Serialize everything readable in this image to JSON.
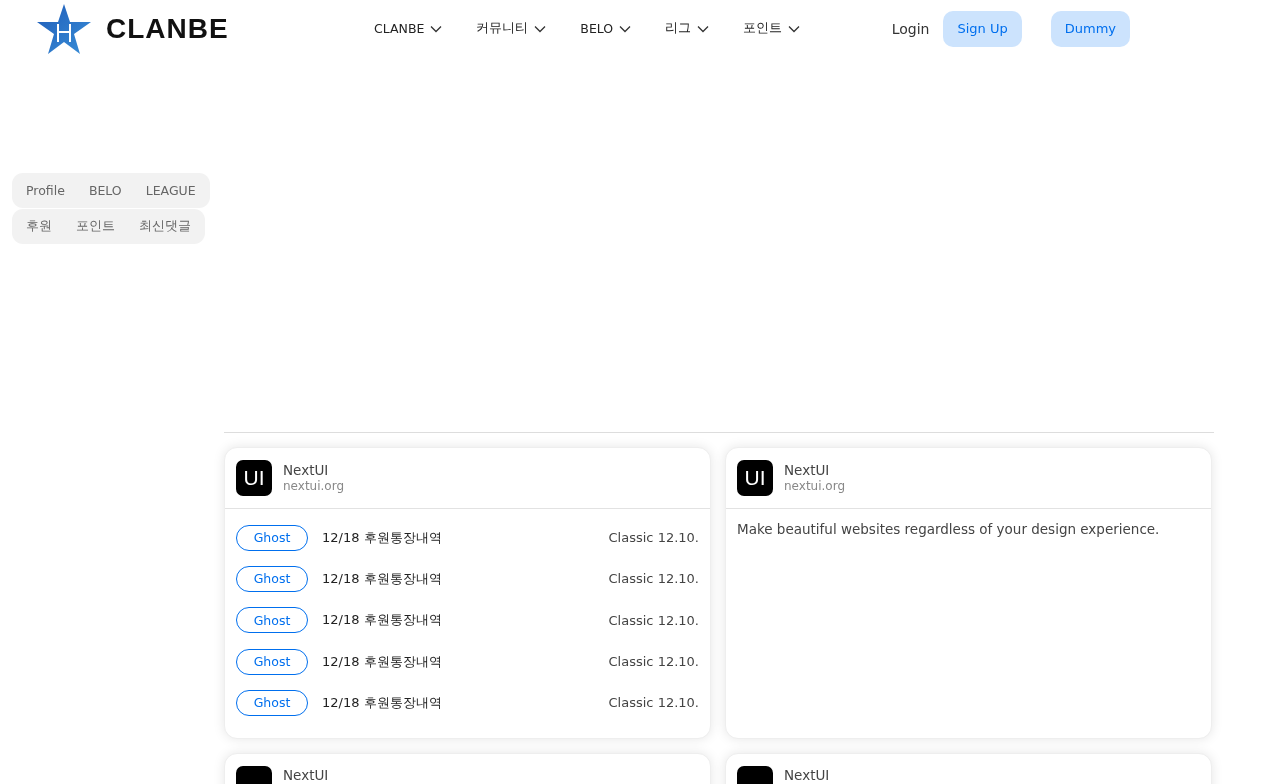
{
  "header": {
    "brand": "CLANBE",
    "nav": [
      {
        "label": "CLANBE"
      },
      {
        "label": "커뮤니티"
      },
      {
        "label": "BELO"
      },
      {
        "label": "리그"
      },
      {
        "label": "포인트"
      }
    ],
    "login": "Login",
    "signup": "Sign Up",
    "dummy": "Dummy"
  },
  "sidebar": {
    "groups": [
      [
        "Profile",
        "BELO",
        "LEAGUE"
      ],
      [
        "후원",
        "포인트",
        "최신댓글"
      ]
    ]
  },
  "cards": [
    {
      "logo": "UI",
      "title": "NextUI",
      "subtitle": "nextui.org",
      "kind": "list",
      "rows": [
        {
          "button": "Ghost",
          "text": "12/18 후원통장내역",
          "meta": "Classic 12.10."
        },
        {
          "button": "Ghost",
          "text": "12/18 후원통장내역",
          "meta": "Classic 12.10."
        },
        {
          "button": "Ghost",
          "text": "12/18 후원통장내역",
          "meta": "Classic 12.10."
        },
        {
          "button": "Ghost",
          "text": "12/18 후원통장내역",
          "meta": "Classic 12.10."
        },
        {
          "button": "Ghost",
          "text": "12/18 후원통장내역",
          "meta": "Classic 12.10."
        }
      ]
    },
    {
      "logo": "UI",
      "title": "NextUI",
      "subtitle": "nextui.org",
      "kind": "text",
      "body": "Make beautiful websites regardless of your design experience."
    },
    {
      "title": "NextUI",
      "kind": "cut"
    },
    {
      "title": "NextUI",
      "kind": "cut"
    }
  ]
}
